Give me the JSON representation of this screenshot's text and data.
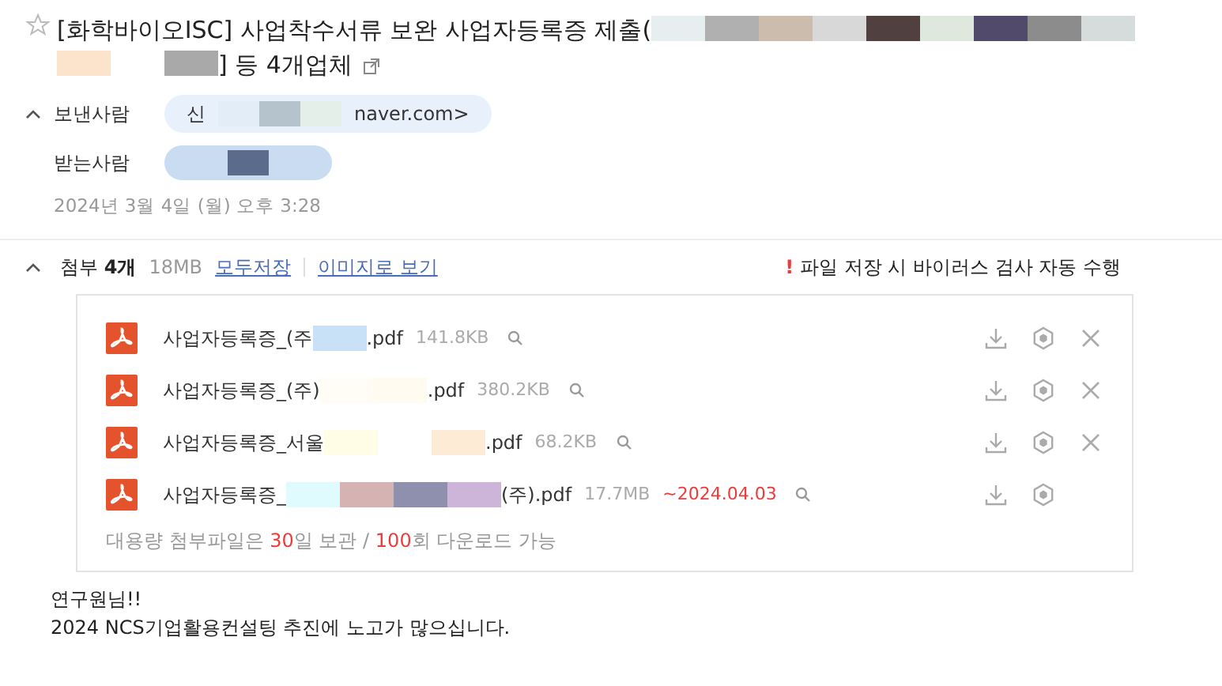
{
  "message": {
    "starred": false,
    "subject": [
      {
        "kind": "text",
        "text": "[화학바이오ISC] 사업착수서류 보완 사업자등록증 제출("
      },
      {
        "kind": "redacted"
      },
      {
        "kind": "redacted"
      },
      {
        "kind": "text",
        "text": "] 등 4개업체"
      }
    ],
    "sender": {
      "label": "보낸사람",
      "expanded": true,
      "parts": [
        {
          "kind": "text",
          "text": "신"
        },
        {
          "kind": "redacted"
        },
        {
          "kind": "text",
          "text": "naver.com>"
        }
      ]
    },
    "recipient": {
      "label": "받는사람",
      "parts": [
        {
          "kind": "redacted"
        }
      ]
    },
    "date": "2024년 3월 4일 (월) 오후 3:28"
  },
  "attachments": {
    "expanded": true,
    "title": "첨부 **4개**",
    "total_size": "18MB",
    "save_all": "모두저장",
    "view_as_image": "이미지로 보기",
    "warning_mark": "!",
    "warning": "파일 저장 시 바이러스 검사 자동 수행",
    "files": [
      {
        "name": [
          {
            "kind": "text",
            "text": "사업자등록증_(주"
          },
          {
            "kind": "redacted"
          },
          {
            "kind": "text",
            "text": ".pdf"
          }
        ],
        "size": "141.8KB",
        "removable": true
      },
      {
        "name": [
          {
            "kind": "text",
            "text": "사업자등록증_(주)"
          },
          {
            "kind": "redacted"
          },
          {
            "kind": "text",
            "text": ".pdf"
          }
        ],
        "size": "380.2KB",
        "removable": true
      },
      {
        "name": [
          {
            "kind": "text",
            "text": "사업자등록증_서울"
          },
          {
            "kind": "redacted"
          },
          {
            "kind": "text",
            "text": ".pdf"
          }
        ],
        "size": "68.2KB",
        "removable": true
      },
      {
        "name": [
          {
            "kind": "text",
            "text": "사업자등록증_"
          },
          {
            "kind": "redacted"
          },
          {
            "kind": "text",
            "text": "(주).pdf"
          }
        ],
        "size": "17.7MB",
        "expiry": "~2024.04.03",
        "removable": false
      }
    ],
    "note": [
      {
        "kind": "text",
        "text": "대용량 첨부파일은 "
      },
      {
        "kind": "highlight",
        "text": "30"
      },
      {
        "kind": "text",
        "text": "일 보관 / "
      },
      {
        "kind": "highlight",
        "text": "100"
      },
      {
        "kind": "text",
        "text": "회 다운로드 가능"
      }
    ]
  },
  "body": [
    "연구원님!!",
    "2024 NCS기업활용컨설팅 추진에 노고가 많으십니다."
  ]
}
